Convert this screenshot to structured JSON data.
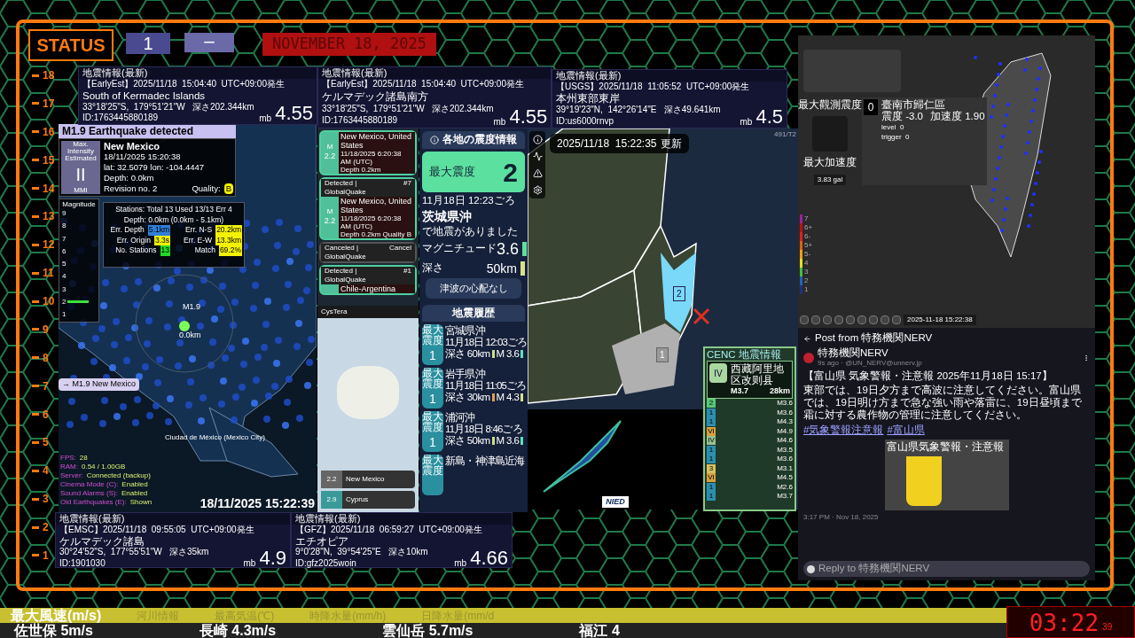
{
  "header": {
    "status": "STATUS",
    "box_1": "1",
    "box_2": "ー",
    "date": "NOVEMBER 18, 2025"
  },
  "ruler": [
    "18",
    "17",
    "16",
    "15",
    "14",
    "13",
    "12",
    "11",
    "10",
    "9",
    "8",
    "7",
    "6",
    "5",
    "4",
    "3",
    "2",
    "1"
  ],
  "quake_cards": [
    {
      "title": "地震情報(最新)",
      "source": "【EarlyEst】2025/11/18  15:04:40  UTC+09:00発生",
      "place": "South of Kermadec Islands",
      "coords": "33°18'25\"S,  179°51'21\"W   深さ202.344km",
      "id": "ID:1763445880189",
      "mag_type": "mb",
      "mag": "4.55"
    },
    {
      "title": "地震情報(最新)",
      "source": "【EarlyEst】2025/11/18  15:04:40  UTC+09:00発生",
      "place": "ケルマデック諸島南方",
      "coords": "33°18'25\"S,  179°51'21\"W   深さ202.344km",
      "id": "ID:1763445880189",
      "mag_type": "mb",
      "mag": "4.55"
    },
    {
      "title": "地震情報(最新)",
      "source": "【USGS】2025/11/18  11:05:52  UTC+09:00発生",
      "place": "本州東部東岸",
      "coords": "39°19'23\"N,  142°26'14\"E   深さ49.641km",
      "id": "ID:us6000rnvp",
      "mag_type": "mb",
      "mag": "4.5"
    },
    {
      "title": "地震情報(最新)",
      "source": "【EMSC】2025/11/18  09:55:05  UTC+09:00発生",
      "place": "ケルマデック諸島",
      "coords": "30°24'52\"S,  177°55'51\"W   深さ35km",
      "id": "ID:1901030",
      "mag_type": "mb",
      "mag": "4.9"
    },
    {
      "title": "地震情報(最新)",
      "source": "【GFZ】2025/11/18  06:59:27  UTC+09:00発生",
      "place": "エチオピア",
      "coords": "9°0'28\"N,  39°54'25\"E   深さ10km",
      "id": "ID:gfz2025woin",
      "mag_type": "mb",
      "mag": "4.66"
    }
  ],
  "globalquake": {
    "banner": "M1.9 Earthquake detected",
    "intensity_label": "Max. Intensity Estimated",
    "intensity": "II",
    "intensity_scale": "MMI",
    "region": "New Mexico",
    "time": "18/11/2025 15:20:38",
    "latlon": "lat: 32.5079 lon: -104.4447",
    "depth": "Depth: 0.0km",
    "revision": "Revision no. 2",
    "quality_label": "Quality:",
    "quality": "B",
    "magnitude_label": "Magnitude",
    "magnitude_ticks": [
      "9",
      "8",
      "7",
      "6",
      "5",
      "4",
      "3",
      "2",
      "1"
    ],
    "stations": "Stations: Total 13 Used 13/13 Err 4",
    "depth_range": "Depth: 0.0km (0.0km - 5.1km)",
    "errors": [
      {
        "label": "Err. Depth",
        "value": "5.1km",
        "color": "#2f7fd8"
      },
      {
        "label": "Err. N-S",
        "value": "20.2km",
        "color": "#f2f200"
      },
      {
        "label": "Err. Origin",
        "value": "3.3s",
        "color": "#f2f200"
      },
      {
        "label": "Err. E-W",
        "value": "13.3km",
        "color": "#f2f200"
      },
      {
        "label": "No. Stations",
        "value": "13",
        "color": "#22dd22"
      },
      {
        "label": "Match",
        "value": "69.2%",
        "color": "#f2f200"
      }
    ],
    "map_mag": "M1.9",
    "map_depth": "0.0km",
    "city": "Ciudad de México (Mexico City)",
    "event_link": "→ M1.9 New Mexico",
    "stats": [
      {
        "label": "FPS:",
        "value": "28"
      },
      {
        "label": "RAM:",
        "value": "0.54 / 1.00GB"
      },
      {
        "label": "Server:",
        "value": "Connected (backup)"
      },
      {
        "label": "Cinema Mode (C):",
        "value": "Enabled"
      },
      {
        "label": "Sound Alarms (S):",
        "value": "Enabled"
      },
      {
        "label": "Old Earthquakes (E):",
        "value": "Shown"
      }
    ],
    "timestamp": "18/11/2025 15:22:39"
  },
  "quake_list": [
    {
      "m_label": "M",
      "mag": "2.2",
      "place": "New Mexico, United States",
      "time": "11/18/2025 6:20:38 AM (UTC)",
      "detail": "Depth 0.2km",
      "canceled": false
    },
    {
      "header": "Detected | GlobalQuake",
      "tag": "#7",
      "m_label": "M",
      "mag": "2.2",
      "place": "New Mexico, United States",
      "time": "11/18/2025 6:20:38 AM (UTC)",
      "detail": "Depth 0.2km   Quality B",
      "canceled": false
    },
    {
      "header": "Canceled | GlobalQuake",
      "tag": "Cancel",
      "canceled": true
    },
    {
      "header": "Detected | GlobalQuake",
      "tag": "#1",
      "place": "Chile-Argentina",
      "canceled": false
    }
  ],
  "cystera": {
    "title": "CysTera",
    "items": [
      {
        "mag": "2.2",
        "place": "New Mexico"
      },
      {
        "mag": "2.9",
        "place": "Cyprus"
      }
    ]
  },
  "shindo": {
    "title": "各地の震度情報",
    "max_label": "最大震度",
    "max": "2",
    "time": "11月18日 12:23ごろ",
    "place": "茨城県沖",
    "note": "で地震がありました",
    "mag_label": "マグニチュード",
    "mag": "3.6",
    "depth_label": "深さ",
    "depth": "50km",
    "tsunami": "津波の心配なし",
    "history_title": "地震履歴",
    "history": [
      {
        "badge": "最大震度",
        "intensity": "1",
        "place": "宮城県沖",
        "time": "11月18日 12:03ごろ",
        "depth_label": "深さ",
        "depth": "60km",
        "depth_bar": {
          "color": "#c9e08a"
        },
        "mag": "M 3.6",
        "mag_bar": {
          "color": "#5fe0c0"
        }
      },
      {
        "badge": "最大震度",
        "intensity": "1",
        "place": "岩手県沖",
        "time": "11月18日 11:05ごろ",
        "depth_label": "深さ",
        "depth": "30km",
        "depth_bar": {
          "color": "#e0a050"
        },
        "mag": "M 4.3",
        "mag_bar": {
          "color": "#d8e08a"
        }
      },
      {
        "badge": "最大震度",
        "intensity": "1",
        "place": "浦河沖",
        "time": "11月18日 8:46ごろ",
        "depth_label": "深さ",
        "depth": "50km",
        "depth_bar": {
          "color": "#c9e08a"
        },
        "mag": "M 3.6",
        "mag_bar": {
          "color": "#5fe0c0"
        }
      },
      {
        "badge": "最大震度",
        "place": "新島・神津島近海"
      }
    ]
  },
  "jmap": {
    "time": "2025/11/18  15:22:35",
    "updated": "更新",
    "counter": "491/T2",
    "areas": [
      "2",
      "1"
    ]
  },
  "cenc": {
    "title": "CENC 地震情報",
    "intensity": "IV",
    "place": "西藏阿里地区改则县",
    "mag": "M3.7",
    "depth": "28km",
    "list": [
      {
        "intensity": "2",
        "mag": "M3.6",
        "color": "#58c878"
      },
      {
        "intensity": "1",
        "mag": "M3.6",
        "color": "#2b8fb0"
      },
      {
        "intensity": "1",
        "mag": "M4.3",
        "color": "#2b8fb0"
      },
      {
        "intensity": "VI",
        "mag": "M4.9",
        "color": "#d8a040"
      },
      {
        "intensity": "IV",
        "mag": "M4.6",
        "color": "#98c090"
      },
      {
        "intensity": "1",
        "mag": "M3.5",
        "color": "#2b8fb0"
      },
      {
        "intensity": "1",
        "mag": "M3.6",
        "color": "#2b8fb0"
      },
      {
        "intensity": "3",
        "mag": "M3.1",
        "color": "#d8c060"
      },
      {
        "intensity": "VI",
        "mag": "M4.5",
        "color": "#d8a040"
      },
      {
        "intensity": "1",
        "mag": "M2.6",
        "color": "#2b8fb0"
      },
      {
        "intensity": "1",
        "mag": "M3.7",
        "color": "#2b8fb0"
      }
    ]
  },
  "nied": {
    "logo": "NIED"
  },
  "taiwan": {
    "max_obs_label": "最大觀測震度",
    "value": "0",
    "place": "臺南市歸仁區",
    "intensity": "震度 -3.0",
    "accel": "加速度 1.90",
    "level": "level  0",
    "trigger": "trigger  0",
    "max_acc_label": "最大加速度",
    "max_acc": "3.83 gal",
    "scale": [
      "7",
      "6+",
      "6-",
      "5+",
      "5-",
      "4",
      "3",
      "2",
      "1"
    ],
    "timestamp": "2025-11-18 15:22:38"
  },
  "nerv": {
    "title": "Post from 特務機関NERV",
    "author": "特務機関NERV",
    "handle": "9s ago · @UN_NERV@unnerv.jp",
    "headline": "【富山県 気象警報・注意報 2025年11月18日 15:17】",
    "body": "東部では、19日夕方まで高波に注意してください。富山県では、19日明け方まで急な強い雨や落雷に、19日昼頃まで霜に対する農作物の管理に注意してください。",
    "hashtags": [
      "#気象警報注意報",
      "#富山県"
    ],
    "image_title": "富山県気象警報・注意報",
    "posted": "3:17 PM · Nov 18, 2025",
    "reply": "Reply to 特務機関NERV"
  },
  "ticker": {
    "top": [
      {
        "text": "最大風速(m/s)",
        "selected": true
      },
      {
        "text": "河川情報",
        "selected": false
      },
      {
        "text": "最高気温(℃)",
        "selected": false
      },
      {
        "text": "時降水量(mm/h)",
        "selected": false
      },
      {
        "text": "日降水量(mm/d",
        "selected": false
      }
    ],
    "bottom": [
      "佐世保 5m/s",
      "長崎 4.3m/s",
      "雲仙岳 5.7m/s",
      "福江 4"
    ]
  },
  "clock": {
    "time": "03:22",
    "seconds": "39"
  }
}
